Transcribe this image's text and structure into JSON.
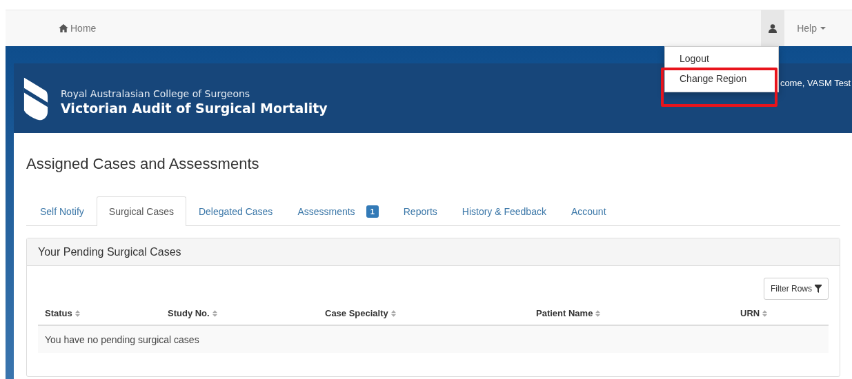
{
  "navbar": {
    "home": "Home",
    "help": "Help",
    "user_menu": {
      "expanded": true,
      "items": [
        {
          "label": "Logout",
          "highlighted": false
        },
        {
          "label": "Change Region",
          "highlighted": true
        }
      ]
    }
  },
  "header": {
    "org": "Royal Australasian College of Surgeons",
    "title": "Victorian Audit of Surgical Mortality",
    "welcome": "come, VASM Test"
  },
  "page_title": "Assigned Cases and Assessments",
  "tabs": [
    {
      "label": "Self Notify",
      "selected": false
    },
    {
      "label": "Surgical Cases",
      "selected": true
    },
    {
      "label": "Delegated Cases",
      "selected": false
    },
    {
      "label": "Assessments",
      "selected": false,
      "badge": "1"
    },
    {
      "label": "Reports",
      "selected": false
    },
    {
      "label": "History & Feedback",
      "selected": false
    },
    {
      "label": "Account",
      "selected": false
    }
  ],
  "panel": {
    "title": "Your Pending Surgical Cases",
    "filter_button": "Filter Rows",
    "table": {
      "columns": [
        "Status",
        "Study No.",
        "Case Specialty",
        "Patient Name",
        "URN"
      ],
      "empty_message": "You have no pending surgical cases"
    }
  }
}
